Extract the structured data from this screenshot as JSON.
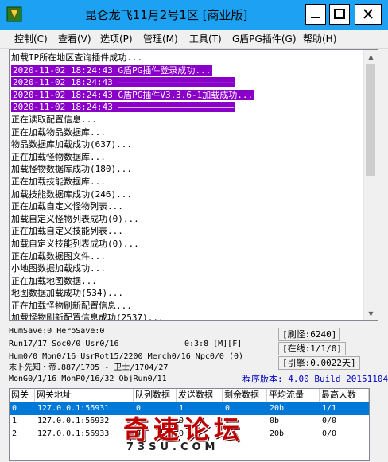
{
  "window": {
    "title": "昆仑龙飞11月2号1区 [商业版]",
    "accent_color": "#1da1f2"
  },
  "menu": [
    "控制(C)",
    "查看(V)",
    "选项(P)",
    "管理(M)",
    "工具(T)",
    "G盾PG插件(G)",
    "帮助(H)"
  ],
  "log": {
    "lines": [
      "加载IP所在地区查询插件成功...",
      "2020-11-02 18:24:43 G盾PG插件登录成功...",
      "2020-11-02 18:24:43 ——————————————————————",
      "2020-11-02 18:24:43 G盾PG插件V3.3.6-1加载成功...",
      "2020-11-02 18:24:43 ——————————————————————",
      "正在读取配置信息...",
      "正在加载物品数据库...",
      "物品数据库加载成功(637)...",
      "正在加载怪物数据库...",
      "加载怪物数据库成功(180)...",
      "正在加载技能数据库...",
      "加载技能数据库成功(246)...",
      "正在加载自定义怪物列表...",
      "加载自定义怪物列表成功(0)...",
      "正在加载自定义技能列表...",
      "加载自定义技能列表成功(0)...",
      "正在加载数据图文件...",
      "小地图数据加载成功...",
      "正在加载地图数据...",
      "地图数据加载成功(534)...",
      "正在加载怪物刷新配置信息...",
      "加载怪物刷新配置信息成功(2537)..."
    ],
    "highlight_color": "#8a00c8"
  },
  "status": {
    "line1": "HumSave:0 HeroSave:0",
    "line2": "Run17/17 Soc0/0 Usr0/16",
    "line2b": "0:3:8 [M][F]",
    "line3": "Hum0/0 Mon0/16 UsrRot15/2200 Merch0/16 Npc0/0 (0)",
    "line4": "末卜先知・帝.887/1705 - 卫士/1704/27",
    "line5": "MonG0/1/16 MonP0/16/32 ObjRun0/11",
    "refresh": "[刷怪:6240]",
    "online": "[在线:1/1/0]",
    "engine": "[引擎:0.0022天]",
    "version": "程序版本: 4.00 Build 20151104"
  },
  "table": {
    "columns": [
      "网关",
      "网关地址",
      "队列数据",
      "发送数据",
      "剩余数据",
      "平均流量",
      "最高人数"
    ],
    "rows": [
      [
        "0",
        "127.0.0.1:56931",
        "0",
        "1",
        "0",
        "20b",
        "1/1"
      ],
      [
        "1",
        "127.0.0.1:56932",
        "0",
        "0",
        "0",
        "0b",
        "0/0"
      ],
      [
        "2",
        "127.0.0.1:56933",
        "0",
        "0",
        "0",
        "20b",
        "0/0"
      ]
    ],
    "selected_color": "#0078d7"
  },
  "watermark": {
    "main": "奇速论坛",
    "sub": "73SU.COM"
  }
}
